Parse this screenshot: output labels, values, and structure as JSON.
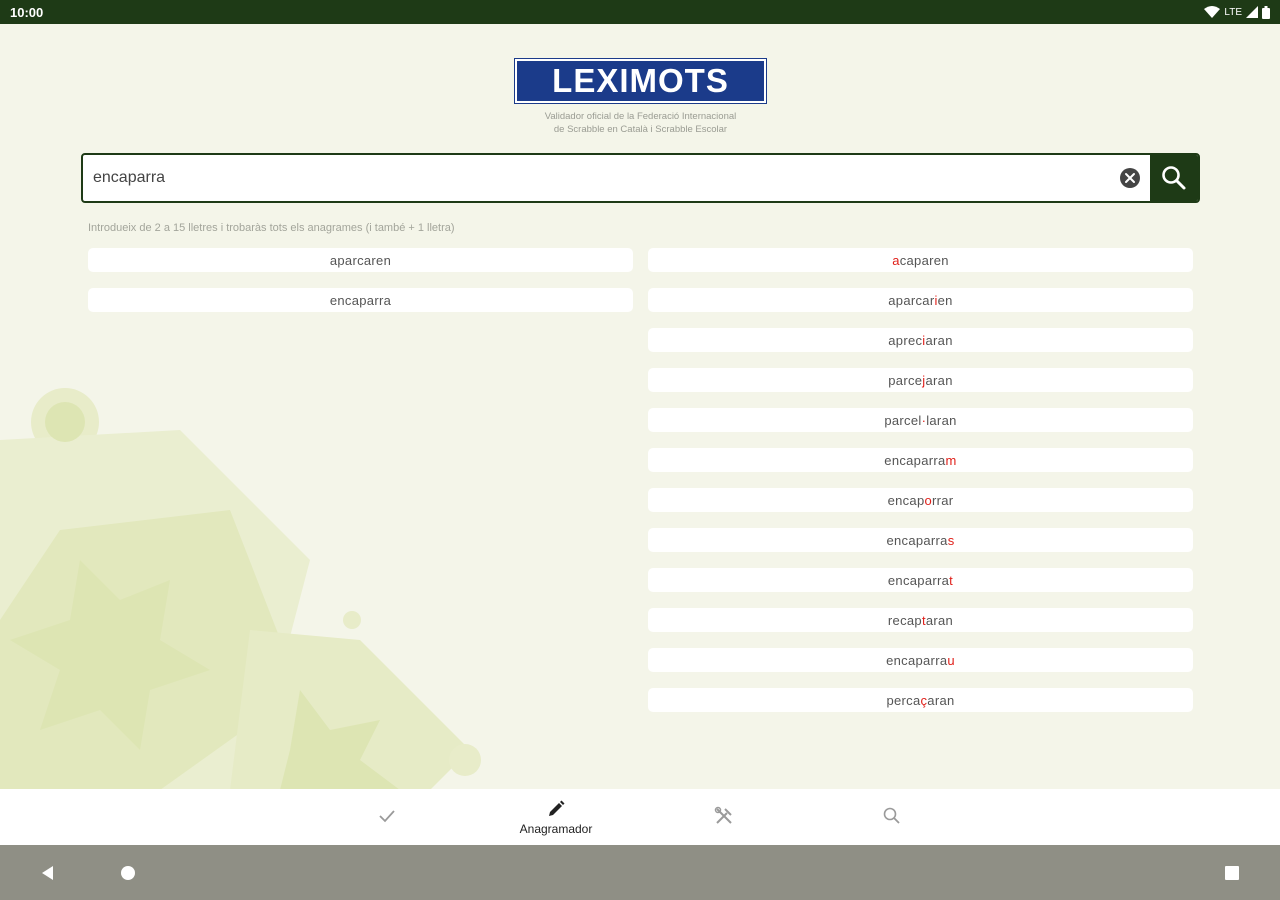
{
  "status_bar": {
    "time": "10:00",
    "network": "LTE"
  },
  "logo": {
    "text": "LEXIMOTS",
    "subtitle_line1": "Validador oficial de la Federació Internacional",
    "subtitle_line2": "de Scrabble en Català i Scrabble Escolar"
  },
  "search": {
    "value": "encaparra",
    "placeholder": ""
  },
  "hint": "Introdueix de 2 a 15 lletres i trobaràs tots els anagrames (i també + 1 lletra)",
  "results_exact": [
    {
      "parts": [
        [
          "aparcaren",
          false
        ]
      ]
    },
    {
      "parts": [
        [
          "encaparra",
          false
        ]
      ]
    }
  ],
  "results_plus_one": [
    {
      "parts": [
        [
          "a",
          true
        ],
        [
          "caparen",
          false
        ]
      ]
    },
    {
      "parts": [
        [
          "aparcar",
          false
        ],
        [
          "i",
          true
        ],
        [
          "en",
          false
        ]
      ]
    },
    {
      "parts": [
        [
          "aprec",
          false
        ],
        [
          "i",
          true
        ],
        [
          "aran",
          false
        ]
      ]
    },
    {
      "parts": [
        [
          "parce",
          false
        ],
        [
          "j",
          true
        ],
        [
          "aran",
          false
        ]
      ]
    },
    {
      "parts": [
        [
          "parcel",
          false
        ],
        [
          "·",
          true
        ],
        [
          "laran",
          false
        ]
      ]
    },
    {
      "parts": [
        [
          "encaparra",
          false
        ],
        [
          "m",
          true
        ]
      ]
    },
    {
      "parts": [
        [
          "encap",
          false
        ],
        [
          "o",
          true
        ],
        [
          "rrar",
          false
        ]
      ]
    },
    {
      "parts": [
        [
          "encaparra",
          false
        ],
        [
          "s",
          true
        ]
      ]
    },
    {
      "parts": [
        [
          "encaparra",
          false
        ],
        [
          "t",
          true
        ]
      ]
    },
    {
      "parts": [
        [
          "recap",
          false
        ],
        [
          "t",
          true
        ],
        [
          "aran",
          false
        ]
      ]
    },
    {
      "parts": [
        [
          "encaparra",
          false
        ],
        [
          "u",
          true
        ]
      ]
    },
    {
      "parts": [
        [
          "perca",
          false
        ],
        [
          "ç",
          true
        ],
        [
          "aran",
          false
        ]
      ]
    }
  ],
  "bottom_nav": {
    "items": [
      {
        "icon": "check-icon",
        "label": "",
        "active": false
      },
      {
        "icon": "pencil-icon",
        "label": "Anagramador",
        "active": true
      },
      {
        "icon": "tools-icon",
        "label": "",
        "active": false
      },
      {
        "icon": "search-icon",
        "label": "",
        "active": false
      }
    ]
  },
  "colors": {
    "primary_green": "#1e3a16",
    "logo_blue": "#1b3b8a",
    "background": "#f4f5e9",
    "highlight_red": "#e0201a",
    "system_bar": "#8f8f85"
  }
}
